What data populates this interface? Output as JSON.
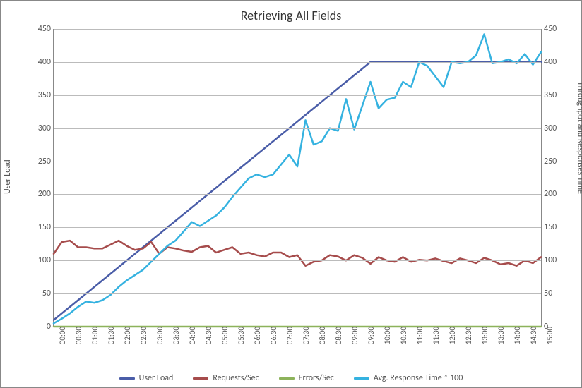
{
  "chart_data": {
    "type": "line",
    "title": "Retrieving All Fields",
    "y_left_label": "User Load",
    "y_right_label": "Throughput and Responses Time",
    "y_left": {
      "min": 0,
      "max": 450,
      "step": 50
    },
    "y_right": {
      "min": 0,
      "max": 450,
      "step": 50
    },
    "x": [
      "00:00",
      "00:30",
      "01:00",
      "01:30",
      "02:00",
      "02:30",
      "03:00",
      "03:30",
      "04:00",
      "04:30",
      "05:00",
      "05:30",
      "06:00",
      "06:30",
      "07:00",
      "07:30",
      "08:00",
      "08:30",
      "09:00",
      "09:30",
      "10:00",
      "10:30",
      "11:00",
      "11:30",
      "12:00",
      "12:30",
      "13:00",
      "13:30",
      "14:00",
      "14:30",
      "15:00"
    ],
    "x_minor": [
      "00:00",
      "00:15",
      "00:30",
      "00:45",
      "01:00",
      "01:15",
      "01:30",
      "01:45",
      "02:00",
      "02:15",
      "02:30",
      "02:45",
      "03:00",
      "03:15",
      "03:30",
      "03:45",
      "04:00",
      "04:15",
      "04:30",
      "04:45",
      "05:00",
      "05:15",
      "05:30",
      "05:45",
      "06:00",
      "06:15",
      "06:30",
      "06:45",
      "07:00",
      "07:15",
      "07:30",
      "07:45",
      "08:00",
      "08:15",
      "08:30",
      "08:45",
      "09:00",
      "09:15",
      "09:30",
      "09:45",
      "10:00",
      "10:15",
      "10:30",
      "10:45",
      "11:00",
      "11:15",
      "11:30",
      "11:45",
      "12:00",
      "12:15",
      "12:30",
      "12:45",
      "13:00",
      "13:15",
      "13:30",
      "13:45",
      "14:00",
      "14:15",
      "14:30",
      "14:45",
      "15:00"
    ],
    "series": [
      {
        "name": "User Load",
        "axis": "left",
        "color": "#4A5DA8",
        "width": 2.5,
        "values": [
          10,
          20,
          30,
          40,
          50,
          60,
          70,
          80,
          90,
          100,
          110,
          120,
          130,
          140,
          150,
          160,
          170,
          180,
          190,
          200,
          210,
          220,
          230,
          240,
          250,
          260,
          270,
          280,
          290,
          300,
          310,
          320,
          330,
          340,
          350,
          360,
          370,
          380,
          390,
          400,
          400,
          400,
          400,
          400,
          400,
          400,
          400,
          400,
          400,
          400,
          400,
          400,
          400,
          400,
          400,
          400,
          400,
          400,
          400,
          400,
          400
        ]
      },
      {
        "name": "Requests/Sec",
        "axis": "right",
        "color": "#A64C4C",
        "width": 2.5,
        "values": [
          110,
          128,
          130,
          120,
          120,
          118,
          118,
          124,
          130,
          122,
          116,
          118,
          128,
          110,
          120,
          118,
          115,
          113,
          120,
          122,
          112,
          116,
          120,
          110,
          112,
          108,
          106,
          112,
          112,
          105,
          108,
          92,
          98,
          100,
          108,
          106,
          100,
          108,
          104,
          95,
          105,
          100,
          98,
          105,
          98,
          101,
          100,
          103,
          99,
          96,
          103,
          100,
          96,
          104,
          100,
          94,
          96,
          92,
          100,
          96,
          105
        ]
      },
      {
        "name": "Errors/Sec",
        "axis": "right",
        "color": "#8DB35B",
        "width": 2.5,
        "values": [
          0,
          0,
          0,
          0,
          0,
          0,
          0,
          0,
          0,
          0,
          0,
          0,
          0,
          0,
          0,
          0,
          0,
          0,
          0,
          0,
          0,
          0,
          0,
          0,
          0,
          0,
          0,
          0,
          0,
          0,
          0,
          0,
          0,
          0,
          0,
          0,
          0,
          0,
          0,
          0,
          0,
          0,
          0,
          0,
          0,
          0,
          0,
          0,
          0,
          0,
          0,
          0,
          0,
          0,
          0,
          0,
          0,
          0,
          0,
          0,
          0
        ]
      },
      {
        "name": "Avg. Response Time * 100",
        "axis": "right",
        "color": "#35B2E0",
        "width": 2.5,
        "values": [
          5,
          12,
          20,
          30,
          38,
          36,
          40,
          48,
          60,
          70,
          78,
          86,
          98,
          110,
          122,
          130,
          144,
          158,
          152,
          160,
          168,
          180,
          196,
          210,
          224,
          230,
          226,
          230,
          245,
          260,
          242,
          312,
          275,
          280,
          300,
          296,
          344,
          298,
          334,
          370,
          330,
          343,
          346,
          370,
          362,
          400,
          394,
          378,
          362,
          400,
          398,
          400,
          410,
          442,
          398,
          400,
          404,
          398,
          412,
          396,
          415
        ]
      }
    ],
    "legend": [
      {
        "label": "User Load",
        "color": "#4A5DA8"
      },
      {
        "label": "Requests/Sec",
        "color": "#A64C4C"
      },
      {
        "label": "Errors/Sec",
        "color": "#8DB35B"
      },
      {
        "label": "Avg. Response Time * 100",
        "color": "#35B2E0"
      }
    ]
  }
}
